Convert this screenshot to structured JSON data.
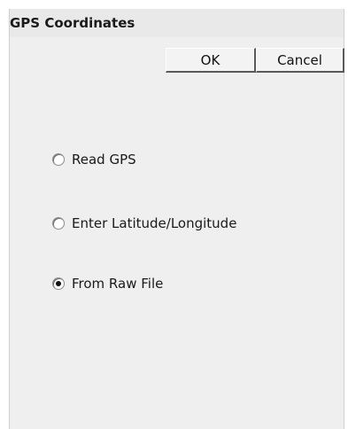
{
  "dialog": {
    "title": "GPS Coordinates",
    "ok_label": "OK",
    "cancel_label": "Cancel",
    "options": [
      {
        "label": "Read GPS",
        "selected": false
      },
      {
        "label": "Enter Latitude/Longitude",
        "selected": false
      },
      {
        "label": "From Raw File",
        "selected": true
      }
    ]
  }
}
